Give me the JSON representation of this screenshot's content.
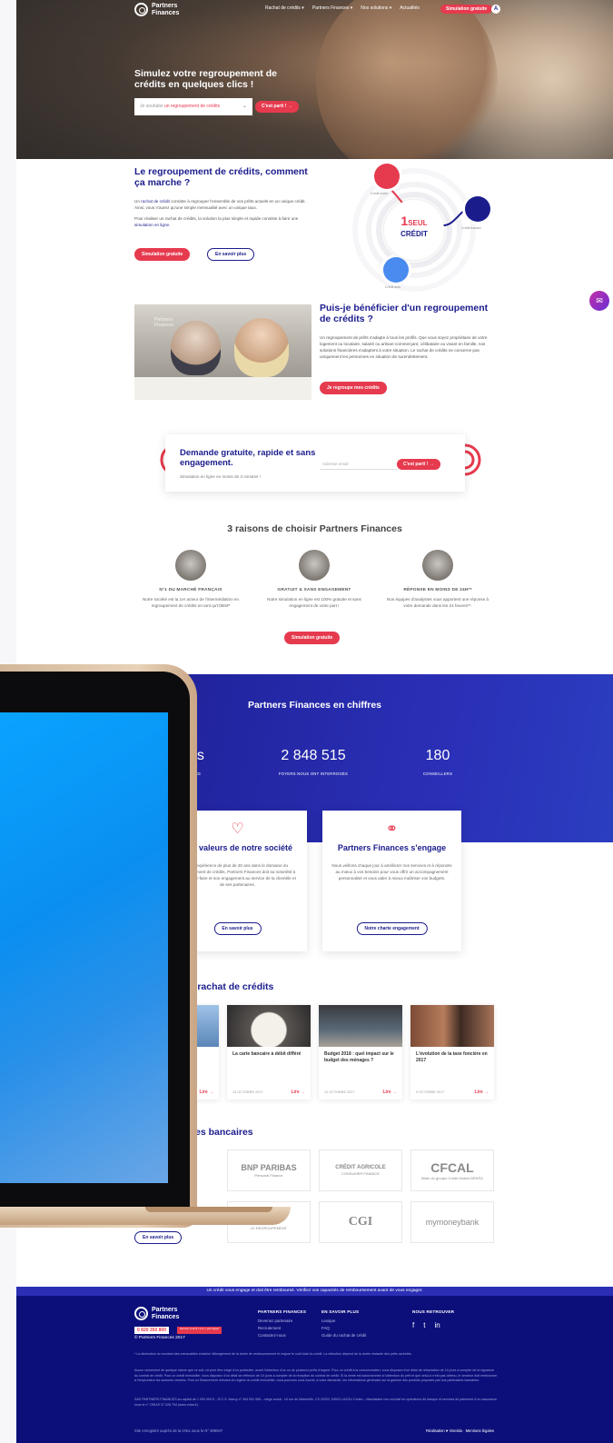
{
  "nav": {
    "logo": [
      "Partners",
      "Finances"
    ],
    "links": [
      "Rachat de crédits ▾",
      "Partners Finances ▾",
      "Nos solutions ▾",
      "Actualités"
    ],
    "cta": "Simulation gratuite",
    "user_icon": "user-icon"
  },
  "hero": {
    "title": "Simulez votre regroupement de crédits en quelques clics !",
    "form_prefix": "Je souhaite",
    "form_value": "un regroupement de crédits",
    "button": "C'est parti ! →"
  },
  "how": {
    "title": "Le regroupement de crédits, comment ça marche ?",
    "p1_a": "Un ",
    "p1_link": "rachat de crédit",
    "p1_b": " consiste à regrouper l'ensemble de vos prêts actuels en un unique crédit. Ainsi, vous n'aurez qu'une simple mensualité avec un unique taux.",
    "p2_a": "Pour réaliser un rachat de crédits, la solution la plus simple et rapide consiste à faire une ",
    "p2_link": "simulation en ligne",
    "p2_b": ".",
    "btn_primary": "Simulation gratuite",
    "btn_secondary": "En savoir plus",
    "diagram_center_1": "1",
    "diagram_center_1b": "SEUL",
    "diagram_center_2": "CRÉDIT",
    "bubble_labels": [
      "Crédit immo",
      "Crédit travaux",
      "Crédit auto"
    ]
  },
  "eligible": {
    "title": "Puis-je bénéficier d'un regroupement de crédits ?",
    "text": "Un regroupement de prêts s'adapte à tous les profils. Que vous soyez propriétaire de votre logement ou locataire, salarié ou artisan-commerçant, célibataire ou vivant en famille, nos solutions financières s'adaptent à votre situation. Le rachat de crédits ne concerne pas uniquement les personnes en situation de surendettement.",
    "button": "Je regroupe mes crédits",
    "photo_watermark": "Partners Finances"
  },
  "request": {
    "title": "Demande gratuite, rapide et sans engagement.",
    "subtitle": "Simulation en ligne en moins de 3 minutes !",
    "placeholder": "Adresse email",
    "button": "C'est parti ! →"
  },
  "reasons": {
    "title": "3 raisons de choisir Partners Finances",
    "items": [
      {
        "heading": "N°1 DU MARCHÉ FRANÇAIS",
        "text": "Notre société est la 1er acteur de l'intermédiation en regroupement de crédits en tant qu'IOBSP",
        "icon": "number-one-icon"
      },
      {
        "heading": "GRATUIT & SANS ENGAGEMENT",
        "text": "Notre simulation en ligne est 100% gratuite et sans engagement de votre part !",
        "icon": "gift-icon"
      },
      {
        "heading": "RÉPONSE EN MOINS DE 24H**",
        "text": "Nos équipes d'analystes vous apportent une réponse à votre demande dans les 24 heures**.",
        "icon": "clock-icon"
      }
    ],
    "button": "Simulation gratuite"
  },
  "stats": {
    "title": "Partners Finances en chiffres",
    "items": [
      {
        "num": "ns",
        "label": "NCE"
      },
      {
        "num": "2 848 515",
        "label": "FOYERS NOUS ONT INTERROGÉS"
      },
      {
        "num": "180",
        "label": "CONSEILLERS"
      }
    ]
  },
  "values": [
    {
      "title": "Les valeurs de notre société",
      "text": "Une expérience de plus de 20 ans dans le domaine du regroupement de crédits, Partners Finances doit sa notoriété à son savoir-faire et son engagement au service de la clientèle et de ses partenaires.",
      "button": "En savoir plus",
      "icon": "heart-icon"
    },
    {
      "title": "Partners Finances s'engage",
      "text": "Nous veillons chaque jour à améliorer nos services et à répondre au mieux à vos besoins pour vous offrir un accompagnement personnalisé et vous aider à mieux maîtriser vos budgets.",
      "button": "Notre charte engagement",
      "icon": "handshake-icon"
    }
  ],
  "news": {
    "title": "u rachat de crédits",
    "items": [
      {
        "title": "La carte bancaire à débit différé",
        "date": "13 OCTOBRE 2017",
        "link": "Lire →"
      },
      {
        "title": "Budget 2018 : quel impact sur le budget des ménages ?",
        "date": "12 OCTOBRE 2017",
        "link": "Lire →"
      },
      {
        "title": "L'évolution de la taxe foncière en 2017",
        "date": "9 OCTOBRE 2017",
        "link": "Lire →"
      }
    ],
    "partial_link": "Lire →"
  },
  "partners": {
    "title": "ires bancaires",
    "button": "En savoir plus",
    "logos": [
      {
        "big": "BNP PARIBAS",
        "small": "Personal Finance"
      },
      {
        "big": "CRÉDIT AGRICOLE",
        "small": "CONSUMER FINANCE"
      },
      {
        "big": "CFCAL",
        "small": "filiale du groupe Crédit Mutuel ARKÉA"
      },
      {
        "big": "creatis",
        "small": "LE REGROUPEMENT"
      },
      {
        "big": "CGI",
        "small": ""
      },
      {
        "big": "mymoneybank",
        "small": ""
      }
    ]
  },
  "footer": {
    "warning": "Un crédit vous engage et doit être remboursé. Vérifiez vos capacités de remboursement avant de vous engager.",
    "phone": "0 820 350 800",
    "phone_tag": "Service 0,12 € / min + prix appel",
    "copyright": "© Partners Finances 2017",
    "col1_title": "PARTNERS FINANCES",
    "col1": [
      "Devenez partenaire",
      "Recrutement",
      "Contactez-nous"
    ],
    "col2_title": "EN SAVOIR PLUS",
    "col2": [
      "Lexique",
      "FAQ",
      "Guide du rachat de crédit"
    ],
    "col3_title": "NOUS RETROUVER",
    "social": [
      "facebook-icon",
      "twitter-icon",
      "linkedin-icon"
    ],
    "legal1": "* La diminution du montant des mensualités entraîne l'allongement de la durée de remboursement et majore le coût total du crédit. La réduction dépend de la durée restante des prêts rachetés.",
    "legal2": "Aucun versement de quelque nature que ce soit, ne peut être exigé d'un particulier, avant l'obtention d'un ou de plusieurs prêts d'argent. Pour un crédit à la consommation, vous disposez d'un délai de rétractation de 14 jours à compter de la signature du contrat de crédit. Pour un crédit immobilier, vous disposez d'un délai de réflexion de 10 jours à compter de la réception du contrat de crédit. Si la vente est subordonnée à l'obtention du prêt et que celui-ci n'est pas obtenu, le vendeur doit rembourser à l'emprunteur les sommes versées. Pour un financement relevant du régime du crédit immobilier, nous pouvons vous fournir, à votre demande, les informations générales sur la gamme des produits proposés par nos partenaires bancaires.",
    "legal3": "SAS PARTNERS FINANCES au capital de 1 000 000 € – R.C.S. Nancy n° 494 051 558 – siège social : 16 rue de Malzéville, CS 20203, 54523 LAXOU Cedex – Mandataire non exclusif en opérations de banque et services de paiement & en assurance sous le n° ORIAS 07 028 794 (www.orias.fr).",
    "bottom_left": "Site enregistré auprès de la CNIL sous le N° 908847",
    "bottom_right": "Réalisation ♥ Viseisla · Mentions légales"
  },
  "colors": {
    "brand_blue": "#1b1c8c",
    "brand_red": "#e63a4e"
  }
}
